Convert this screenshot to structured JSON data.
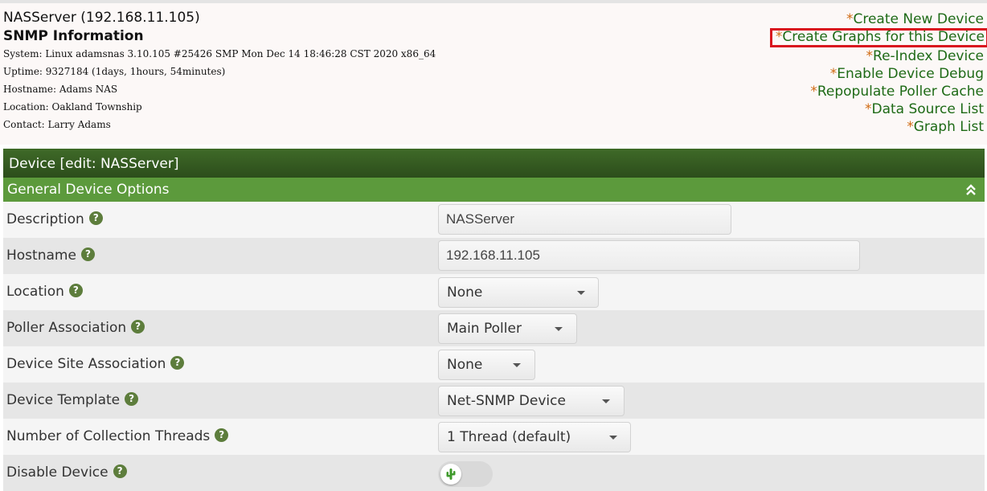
{
  "header": {
    "device_title": "NASServer (192.168.11.105)",
    "snmp_title": "SNMP Information",
    "info": [
      "System: Linux adamsnas 3.10.105 #25426 SMP Mon Dec 14 18:46:28 CST 2020 x86_64",
      "Uptime: 9327184 (1days, 1hours, 54minutes)",
      "Hostname: Adams NAS",
      "Location: Oakland Township",
      "Contact: Larry Adams"
    ]
  },
  "links": {
    "star": "*",
    "items": [
      "Create New Device",
      "Create Graphs for this Device",
      "Re-Index Device",
      "Enable Device Debug",
      "Repopulate Poller Cache",
      "Data Source List",
      "Graph List"
    ],
    "highlight_color": "#d9141e"
  },
  "panel": {
    "title": "Device [edit: NASServer]",
    "section_title": "General Device Options"
  },
  "form": {
    "help_glyph": "?",
    "description": {
      "label": "Description",
      "value": "NASServer"
    },
    "hostname": {
      "label": "Hostname",
      "value": "192.168.11.105"
    },
    "location": {
      "label": "Location",
      "value": "None"
    },
    "poller": {
      "label": "Poller Association",
      "value": "Main Poller"
    },
    "site": {
      "label": "Device Site Association",
      "value": "None"
    },
    "template": {
      "label": "Device Template",
      "value": "Net-SNMP Device"
    },
    "threads": {
      "label": "Number of Collection Threads",
      "value": "1 Thread (default)"
    },
    "disable": {
      "label": "Disable Device",
      "icon": "cactus-icon"
    }
  },
  "colors": {
    "link": "#1e6a16",
    "star": "#d06a12",
    "panel_header": "#2c4d1b",
    "section_header": "#5c9a3c",
    "help_icon": "#5d7d3c"
  }
}
